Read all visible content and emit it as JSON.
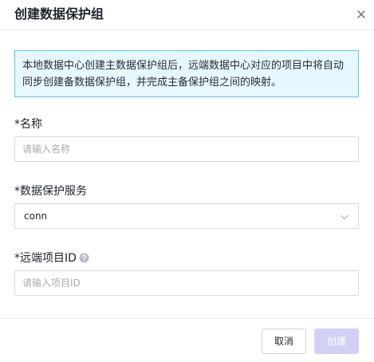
{
  "dialog": {
    "title": "创建数据保护组",
    "close_icon": "close-icon"
  },
  "info": {
    "text": "本地数据中心创建主数据保护组后，远端数据中心对应的项目中将自动同步创建备数据保护组，并完成主备保护组之间的映射。"
  },
  "form": {
    "name": {
      "required_mark": "*",
      "label": "名称",
      "value": "",
      "placeholder": "请输入名称"
    },
    "service": {
      "required_mark": "*",
      "label": "数据保护服务",
      "selected": "conn",
      "arrow_icon": "chevron-down-icon"
    },
    "remote_project": {
      "required_mark": "*",
      "label": "远端项目ID",
      "help_icon": "question-circle-icon",
      "value": "",
      "placeholder": "请输入项目ID"
    }
  },
  "footer": {
    "cancel_label": "取消",
    "create_label": "创建"
  },
  "colors": {
    "info_bg": "#e6f7ff",
    "info_border": "#64c2ec",
    "primary_disabled": "#d3d0f5",
    "border": "#d9d9d9"
  }
}
